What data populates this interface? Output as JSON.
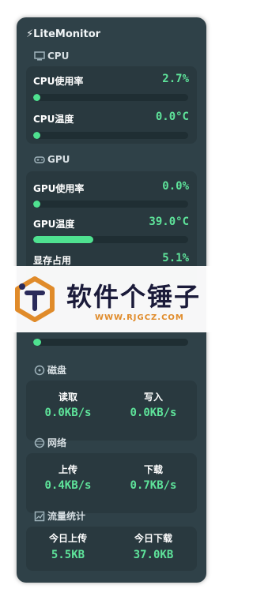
{
  "app": {
    "title": "LiteMonitor"
  },
  "cpu": {
    "section_title": "CPU",
    "usage": {
      "label": "CPU使用率",
      "value": "2.7%",
      "fraction": 0.027
    },
    "temp": {
      "label": "CPU温度",
      "value": "0.0°C",
      "fraction": 0.0
    }
  },
  "gpu": {
    "section_title": "GPU",
    "usage": {
      "label": "GPU使用率",
      "value": "0.0%",
      "fraction": 0.0
    },
    "temp": {
      "label": "GPU温度",
      "value": "39.0°C",
      "fraction": 0.39
    },
    "vram": {
      "label": "显存占用",
      "value": "5.1%",
      "fraction": 0.051
    }
  },
  "disk": {
    "section_title": "磁盘",
    "read": {
      "label": "读取",
      "value": "0.0KB/s"
    },
    "write": {
      "label": "写入",
      "value": "0.0KB/s"
    }
  },
  "network": {
    "section_title": "网络",
    "upload": {
      "label": "上传",
      "value": "0.4KB/s"
    },
    "download": {
      "label": "下载",
      "value": "0.7KB/s"
    }
  },
  "traffic": {
    "section_title": "流量统计",
    "today_upload": {
      "label": "今日上传",
      "value": "5.5KB"
    },
    "today_download": {
      "label": "今日下载",
      "value": "37.0KB"
    }
  },
  "watermark": {
    "text": "软件个锤子",
    "url": "WWW.RJGCZ.COM"
  },
  "colors": {
    "accent": "#4fe190",
    "panel": "#2f4148",
    "card": "#29393f"
  }
}
